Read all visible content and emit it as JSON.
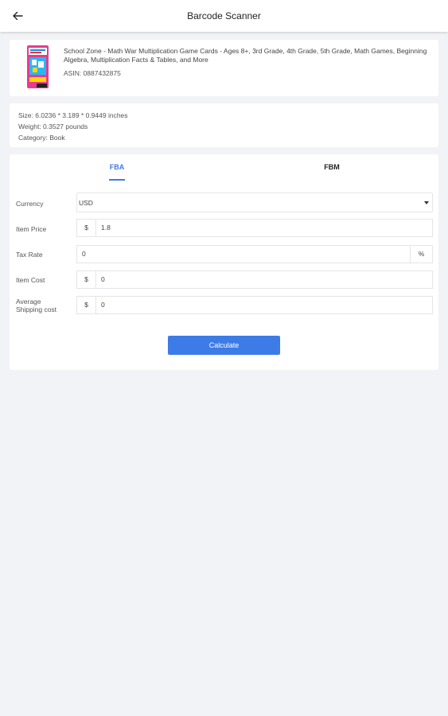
{
  "appbar": {
    "title": "Barcode Scanner",
    "back_icon": "arrow-left-icon"
  },
  "product": {
    "title": "School Zone - Math War Multiplication Game Cards - Ages 8+, 3rd Grade, 4th Grade, 5th Grade, Math Games, Beginning Algebra, Multiplication Facts & Tables, and More",
    "asin": "ASIN: 0887432875",
    "thumb_colors": {
      "box": "#e93a8e",
      "accent": "#29b6f6",
      "yellow": "#ffd600"
    }
  },
  "specs": {
    "size": "Size: 6.0236 * 3.189 * 0.9449 inches",
    "weight": "Weight: 0.3527 pounds",
    "category": "Category: Book"
  },
  "tabs": {
    "fba": "FBA",
    "fbm": "FBM",
    "active": "FBA"
  },
  "form": {
    "currency": {
      "label": "Currency",
      "value": "USD"
    },
    "item_price": {
      "label": "Item Price",
      "prefix": "$",
      "value": "1.8"
    },
    "tax_rate": {
      "label": "Tax Rate",
      "value": "0",
      "suffix": "%"
    },
    "item_cost": {
      "label": "Item Cost",
      "prefix": "$",
      "value": "0"
    },
    "shipping_cost": {
      "label_line1": "Average",
      "label_line2": "Shipping cost",
      "prefix": "$",
      "value": "0"
    }
  },
  "calculate_label": "Calculate",
  "colors": {
    "accent": "#3d7be7",
    "background": "#f1f3f6"
  }
}
